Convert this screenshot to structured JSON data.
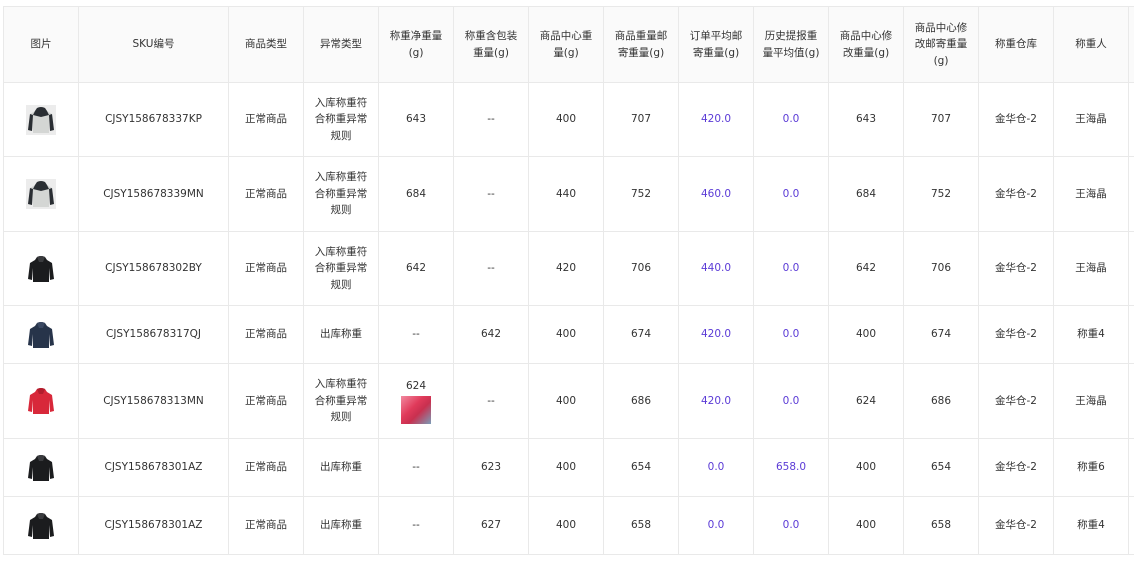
{
  "headers": [
    "图片",
    "SKU编号",
    "商品类型",
    "异常类型",
    "称重净重量(g)",
    "称重含包装重量(g)",
    "商品中心重量(g)",
    "商品重量邮寄重量(g)",
    "订单平均邮寄重量(g)",
    "历史提报重量平均值(g)",
    "商品中心修改重量(g)",
    "商品中心修改邮寄重量(g)",
    "称重仓库",
    "称重人"
  ],
  "rows": [
    {
      "image": "gray-black-hoodie-icon",
      "sku": "CJSY158678337KP",
      "type": "正常商品",
      "exception": "入库称重符合称重异常规则",
      "net": "643",
      "pkg": "--",
      "center": "400",
      "mail": "707",
      "avg_order": "420.0",
      "hist": "0.0",
      "mod": "643",
      "mod_mail": "707",
      "warehouse": "金华仓-2",
      "person": "王海晶"
    },
    {
      "image": "gray-black-hoodie-icon",
      "sku": "CJSY158678339MN",
      "type": "正常商品",
      "exception": "入库称重符合称重异常规则",
      "net": "684",
      "pkg": "--",
      "center": "440",
      "mail": "752",
      "avg_order": "460.0",
      "hist": "0.0",
      "mod": "684",
      "mod_mail": "752",
      "warehouse": "金华仓-2",
      "person": "王海晶"
    },
    {
      "image": "black-hoodie-icon",
      "sku": "CJSY158678302BY",
      "type": "正常商品",
      "exception": "入库称重符合称重异常规则",
      "net": "642",
      "pkg": "--",
      "center": "420",
      "mail": "706",
      "avg_order": "440.0",
      "hist": "0.0",
      "mod": "642",
      "mod_mail": "706",
      "warehouse": "金华仓-2",
      "person": "王海晶"
    },
    {
      "image": "navy-hoodie-icon",
      "sku": "CJSY158678317QJ",
      "type": "正常商品",
      "exception": "出库称重",
      "net": "--",
      "pkg": "642",
      "center": "400",
      "mail": "674",
      "avg_order": "420.0",
      "hist": "0.0",
      "mod": "400",
      "mod_mail": "674",
      "warehouse": "金华仓-2",
      "person": "称重4"
    },
    {
      "image": "red-hoodie-icon",
      "sku": "CJSY158678313MN",
      "type": "正常商品",
      "exception": "入库称重符合称重异常规则",
      "net": "624",
      "pkg": "--",
      "center": "400",
      "mail": "686",
      "avg_order": "420.0",
      "hist": "0.0",
      "mod": "624",
      "mod_mail": "686",
      "warehouse": "金华仓-2",
      "person": "王海晶"
    },
    {
      "image": "black-hoodie-icon",
      "sku": "CJSY158678301AZ",
      "type": "正常商品",
      "exception": "出库称重",
      "net": "--",
      "pkg": "623",
      "center": "400",
      "mail": "654",
      "avg_order": "0.0",
      "hist": "658.0",
      "mod": "400",
      "mod_mail": "654",
      "warehouse": "金华仓-2",
      "person": "称重6"
    },
    {
      "image": "black-hoodie-icon",
      "sku": "CJSY158678301AZ",
      "type": "正常商品",
      "exception": "出库称重",
      "net": "--",
      "pkg": "627",
      "center": "400",
      "mail": "658",
      "avg_order": "0.0",
      "hist": "0.0",
      "mod": "400",
      "mod_mail": "658",
      "warehouse": "金华仓-2",
      "person": "称重4"
    }
  ],
  "colors": {
    "link": "#5b3bd6",
    "border": "#e9e9e9",
    "header_bg": "#fafafa"
  }
}
